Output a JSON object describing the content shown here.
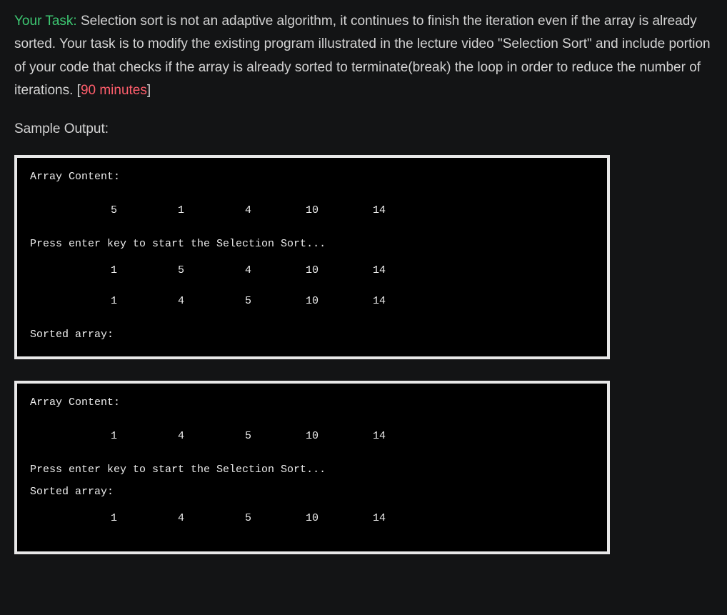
{
  "task": {
    "label": "Your Task:",
    "description": " Selection sort is not an adaptive algorithm, it continues to finish the iteration even if the array is already sorted.  Your task is to modify the existing program illustrated in the lecture video \"Selection Sort\" and include portion of your code that checks if the array is already sorted to terminate(break) the loop in order to reduce the number of iterations. [",
    "time_limit": "90 minutes",
    "closing_bracket": "]"
  },
  "sample_output_heading": "Sample Output:",
  "terminals": [
    {
      "lines": {
        "header": "Array Content:",
        "row1": {
          "v1": "5",
          "v2": "1",
          "v3": "4",
          "v4": "10",
          "v5": "14"
        },
        "prompt": "Press enter key to start the Selection Sort...",
        "row2": {
          "v1": "1",
          "v2": "5",
          "v3": "4",
          "v4": "10",
          "v5": "14"
        },
        "row3": {
          "v1": "1",
          "v2": "4",
          "v3": "5",
          "v4": "10",
          "v5": "14"
        },
        "sorted": "Sorted array:"
      }
    },
    {
      "lines": {
        "header": "Array Content:",
        "row1": {
          "v1": "1",
          "v2": "4",
          "v3": "5",
          "v4": "10",
          "v5": "14"
        },
        "prompt": "Press enter key to start the Selection Sort...",
        "sorted": "Sorted array:",
        "row2": {
          "v1": "1",
          "v2": "4",
          "v3": "5",
          "v4": "10",
          "v5": "14"
        }
      }
    }
  ]
}
